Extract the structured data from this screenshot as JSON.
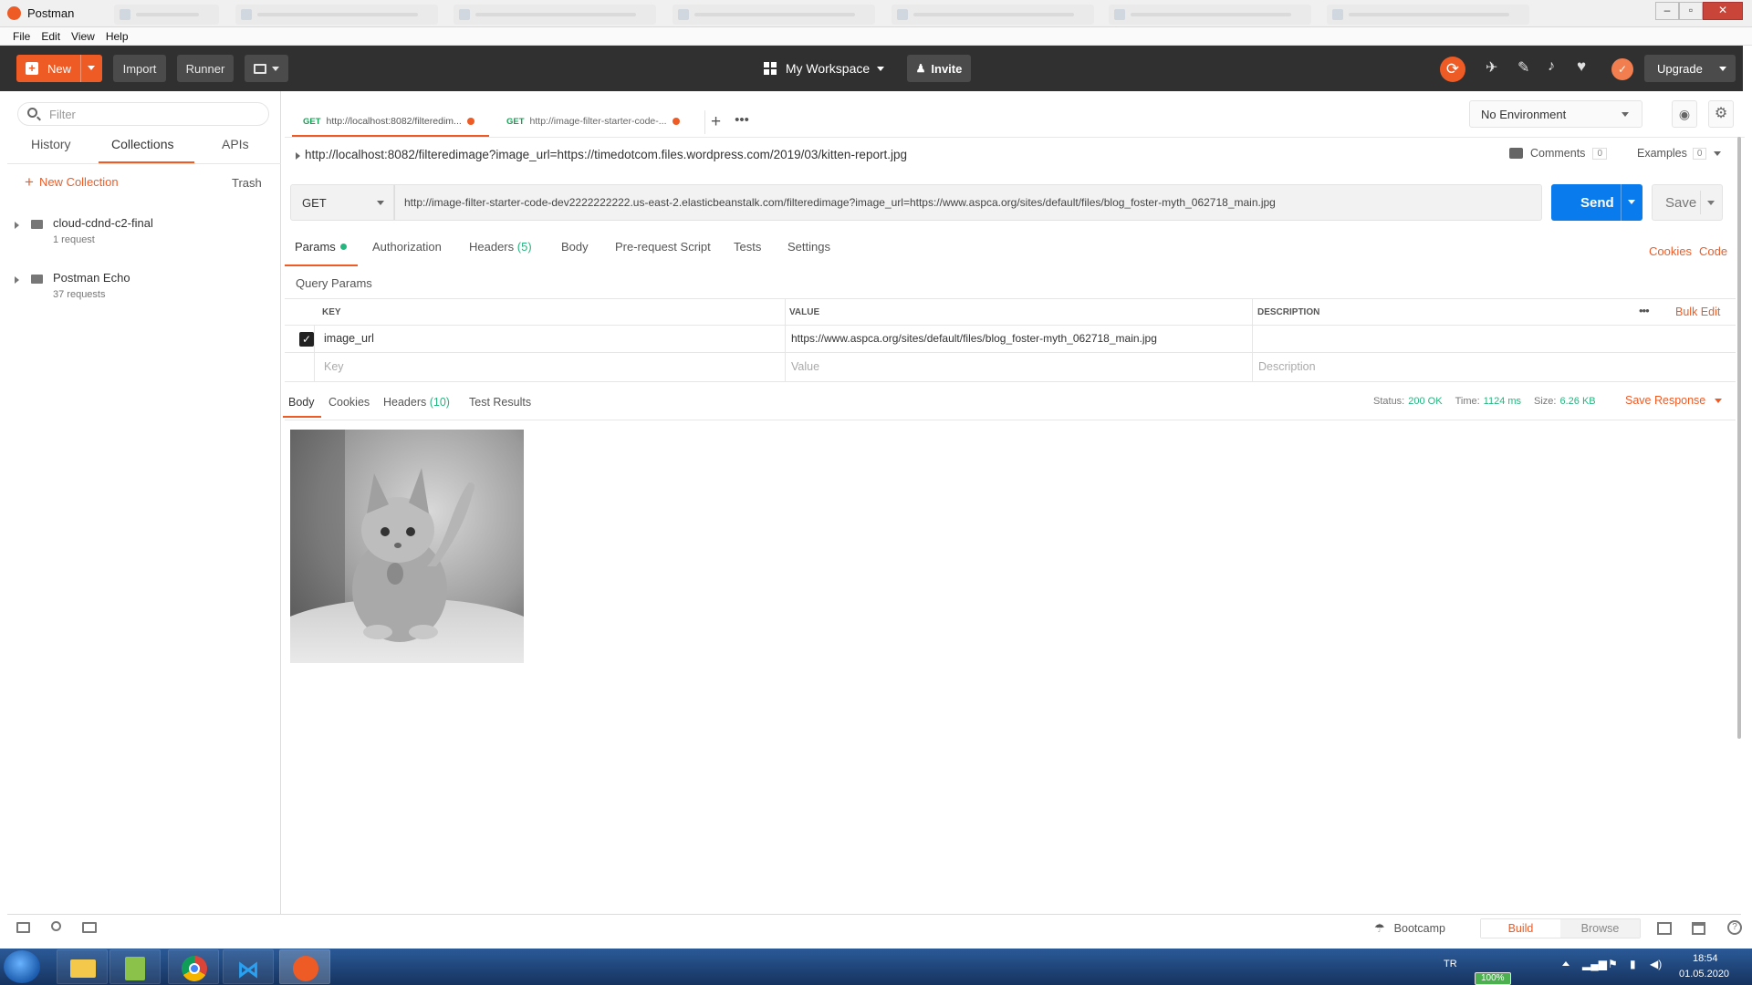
{
  "window": {
    "title": "Postman"
  },
  "menu": [
    "File",
    "Edit",
    "View",
    "Help"
  ],
  "header": {
    "new_label": "New",
    "import_label": "Import",
    "runner_label": "Runner",
    "workspace_label": "My Workspace",
    "invite_label": "Invite",
    "upgrade_label": "Upgrade"
  },
  "sidebar": {
    "filter_placeholder": "Filter",
    "tabs": [
      "History",
      "Collections",
      "APIs"
    ],
    "new_collection_label": "New Collection",
    "trash_label": "Trash",
    "collections": [
      {
        "name": "cloud-cdnd-c2-final",
        "count": "1 request"
      },
      {
        "name": "Postman Echo",
        "count": "37 requests"
      }
    ]
  },
  "request_tabs": [
    {
      "method": "GET",
      "label": "http://localhost:8082/filteredim..."
    },
    {
      "method": "GET",
      "label": "http://image-filter-starter-code-..."
    }
  ],
  "environment": {
    "selected": "No Environment"
  },
  "request": {
    "title_url": "http://localhost:8082/filteredimage?image_url=https://timedotcom.files.wordpress.com/2019/03/kitten-report.jpg",
    "method": "GET",
    "url": "http://image-filter-starter-code-dev2222222222.us-east-2.elasticbeanstalk.com/filteredimage?image_url=https://www.aspca.org/sites/default/files/blog_foster-myth_062718_main.jpg",
    "send_label": "Send",
    "save_label": "Save",
    "comments_label": "Comments",
    "comments_count": "0",
    "examples_label": "Examples",
    "examples_count": "0"
  },
  "request_section_tabs": [
    {
      "label": "Params"
    },
    {
      "label": "Authorization"
    },
    {
      "label": "Headers",
      "count": "(5)"
    },
    {
      "label": "Body"
    },
    {
      "label": "Pre-request Script"
    },
    {
      "label": "Tests"
    },
    {
      "label": "Settings"
    }
  ],
  "right_links": [
    "Cookies",
    "Code"
  ],
  "params": {
    "heading": "Query Params",
    "columns": [
      "KEY",
      "VALUE",
      "DESCRIPTION"
    ],
    "bulk_edit_label": "Bulk Edit",
    "rows": [
      {
        "key": "image_url",
        "value": "https://www.aspca.org/sites/default/files/blog_foster-myth_062718_main.jpg",
        "description": "",
        "checked": true
      }
    ],
    "placeholders": {
      "key": "Key",
      "value": "Value",
      "description": "Description"
    }
  },
  "response": {
    "tabs": [
      {
        "label": "Body"
      },
      {
        "label": "Cookies"
      },
      {
        "label": "Headers",
        "count": "(10)"
      },
      {
        "label": "Test Results"
      }
    ],
    "status_label": "Status:",
    "status_value": "200 OK",
    "time_label": "Time:",
    "time_value": "1124 ms",
    "size_label": "Size:",
    "size_value": "6.26 KB",
    "save_response_label": "Save Response"
  },
  "footer": {
    "bootcamp_label": "Bootcamp",
    "build_label": "Build",
    "browse_label": "Browse"
  },
  "taskbar": {
    "lang": "TR",
    "time": "18:54",
    "date": "01.05.2020",
    "battery": "100%"
  },
  "colors": {
    "accent": "#ef5b25",
    "send": "#097bed",
    "success": "#26b47f",
    "header_bg": "#303030"
  }
}
